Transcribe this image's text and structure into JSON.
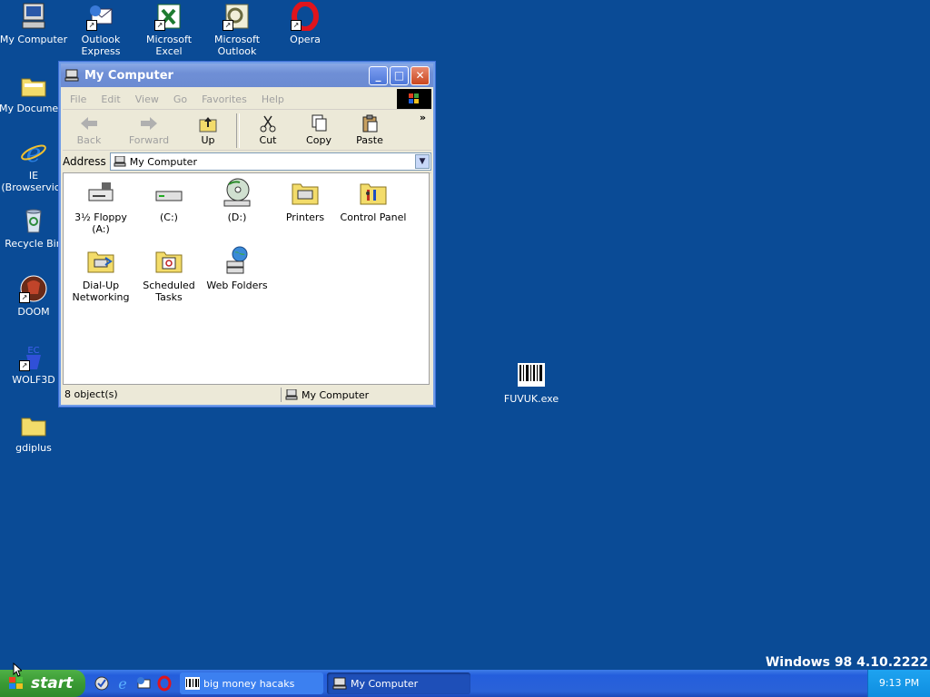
{
  "desktop": {
    "icons": [
      {
        "label": "My Computer",
        "icon": "computer-icon"
      },
      {
        "label": "Outlook\nExpress",
        "icon": "outlook-express-icon"
      },
      {
        "label": "Microsoft\nExcel",
        "icon": "excel-icon"
      },
      {
        "label": "Microsoft\nOutlook",
        "icon": "outlook-icon"
      },
      {
        "label": "Opera",
        "icon": "opera-icon"
      },
      {
        "label": "My Documents",
        "icon": "folder-icon"
      },
      {
        "label": "IE\n(Browservice",
        "icon": "ie-icon"
      },
      {
        "label": "Recycle Bin",
        "icon": "recycle-bin-icon"
      },
      {
        "label": "DOOM",
        "icon": "doom-icon"
      },
      {
        "label": "WOLF3D",
        "icon": "wolf3d-icon"
      },
      {
        "label": "gdiplus",
        "icon": "folder-icon"
      },
      {
        "label": "FUVUK.exe",
        "icon": "barcode-exe-icon"
      }
    ]
  },
  "window": {
    "title": "My Computer",
    "menu": [
      "File",
      "Edit",
      "View",
      "Go",
      "Favorites",
      "Help"
    ],
    "toolbar": {
      "back": "Back",
      "forward": "Forward",
      "up": "Up",
      "cut": "Cut",
      "copy": "Copy",
      "paste": "Paste",
      "more": "»"
    },
    "address": {
      "label": "Address",
      "value": "My Computer"
    },
    "items": [
      {
        "label": "3½ Floppy\n(A:)",
        "icon": "floppy-drive-icon"
      },
      {
        "label": "(C:)",
        "icon": "hard-drive-icon"
      },
      {
        "label": "(D:)",
        "icon": "cd-drive-icon"
      },
      {
        "label": "Printers",
        "icon": "printers-folder-icon"
      },
      {
        "label": "Control Panel",
        "icon": "control-panel-icon"
      },
      {
        "label": "Dial-Up\nNetworking",
        "icon": "dialup-networking-icon"
      },
      {
        "label": "Scheduled\nTasks",
        "icon": "scheduled-tasks-icon"
      },
      {
        "label": "Web Folders",
        "icon": "web-folders-icon"
      }
    ],
    "status": {
      "count": "8 object(s)",
      "location": "My Computer"
    }
  },
  "taskbar": {
    "start_label": "start",
    "quick_launch": [
      "show-desktop-icon",
      "ie-icon",
      "outlook-express-icon",
      "opera-icon"
    ],
    "tasks": [
      {
        "label": "big money hacaks",
        "icon": "barcode-exe-icon"
      },
      {
        "label": "My Computer",
        "icon": "computer-icon"
      }
    ],
    "clock": "9:13 PM"
  },
  "watermark": "Windows 98 4.10.2222"
}
